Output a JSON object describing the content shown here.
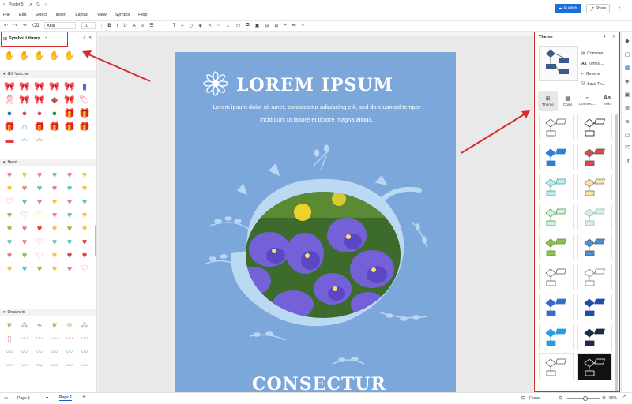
{
  "titlebar": {
    "doc_title": "Poster 5"
  },
  "menubar": {
    "items": [
      "File",
      "Edit",
      "Select",
      "Insert",
      "Layout",
      "View",
      "Symbol",
      "Help"
    ],
    "publish_label": "Publish",
    "share_label": "Share"
  },
  "toolbar": {
    "font": "Arial",
    "size": "10"
  },
  "symbol_library": {
    "title": "Symbol Library",
    "sections": [
      "Gift Voucher",
      "Heart",
      "Ornament"
    ]
  },
  "poster": {
    "title": "LOREM IPSUM",
    "body": "Lorem ipsum dolor sit amet, consectetur adipiscing elit, sed do eiusmod tempor incididunt ut labore et dolore magna aliqua.",
    "footer": "CONSECTUR",
    "background_color": "#7ba7db"
  },
  "theme_panel": {
    "title": "Theme",
    "options": [
      "Common",
      "Times ...",
      "General",
      "Save Th..."
    ],
    "tabs": [
      "Theme",
      "Color",
      "Connect...",
      "Text"
    ]
  },
  "statusbar": {
    "page_select": "Page-1",
    "page_tab": "Page 1",
    "focus_label": "Focus",
    "zoom": "60%"
  },
  "colors": {
    "accent": "#1a6ed8",
    "highlight": "#d62c2c"
  }
}
